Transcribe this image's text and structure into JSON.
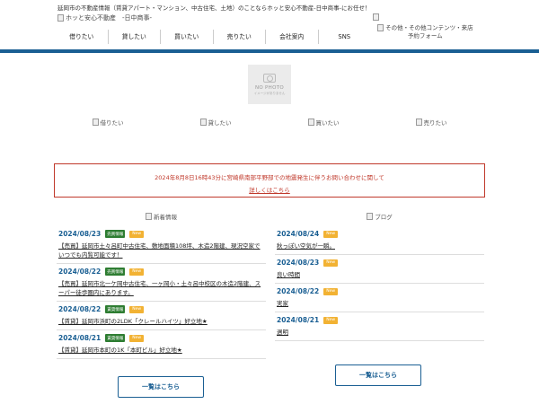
{
  "header": {
    "tagline": "延岡市の不動産情報（賃貸アパート・マンション、中古住宅、土地）のことならホッと安心不動産-日中商事-にお任せ！",
    "logo_alt": "ホッと安心不動産　-日中商事-"
  },
  "nav": {
    "items": [
      {
        "label": "借りたい"
      },
      {
        "label": "貸したい"
      },
      {
        "label": "買いたい"
      },
      {
        "label": "売りたい"
      },
      {
        "label": "会社案内"
      },
      {
        "label": "SNS"
      }
    ],
    "other_line1": "その他・その他コンテンツ・来店",
    "other_line2": "予約フォーム"
  },
  "placeholder": {
    "title": "NO PHOTO",
    "subtitle": "イメージがありません"
  },
  "categories": [
    "借りたい",
    "貸したい",
    "買いたい",
    "売りたい"
  ],
  "notice": {
    "message": "2024年8月8日16時43分に宮崎県南部平野部での地震発生に伴うお問い合わせに関して",
    "link": "詳しくはこちら"
  },
  "news": {
    "heading": "新着情報",
    "items": [
      {
        "date": "2024/08/23",
        "category": "売買情報",
        "badge": "New",
        "title": "【売買】延岡市土々呂町中古住宅、敷地面積108坪、木造2階建、現況空家でいつでも内覧可能です！"
      },
      {
        "date": "2024/08/22",
        "category": "売買情報",
        "badge": "New",
        "title": "【売買】延岡市北一ケ岡中古住宅、一ヶ岡小・土々呂中校区の木造2階建、スーパー徒歩圏内にあります。"
      },
      {
        "date": "2024/08/22",
        "category": "賃貸情報",
        "badge": "New",
        "title": "【賃貸】延岡市浜町の2LDK「クレールハイツ」好立地★"
      },
      {
        "date": "2024/08/21",
        "category": "賃貸情報",
        "badge": "New",
        "title": "【賃貸】延岡市本町の1K「本町ビル」好立地★"
      }
    ],
    "more_label": "一覧はこちら"
  },
  "blog": {
    "heading": "ブログ",
    "items": [
      {
        "date": "2024/08/24",
        "badge": "New",
        "title": "秋っぽい空気が一瞬。"
      },
      {
        "date": "2024/08/23",
        "badge": "New",
        "title": "良い時間"
      },
      {
        "date": "2024/08/22",
        "badge": "New",
        "title": "実家"
      },
      {
        "date": "2024/08/21",
        "badge": "New",
        "title": "週明"
      }
    ],
    "more_label": "一覧はこちら"
  }
}
